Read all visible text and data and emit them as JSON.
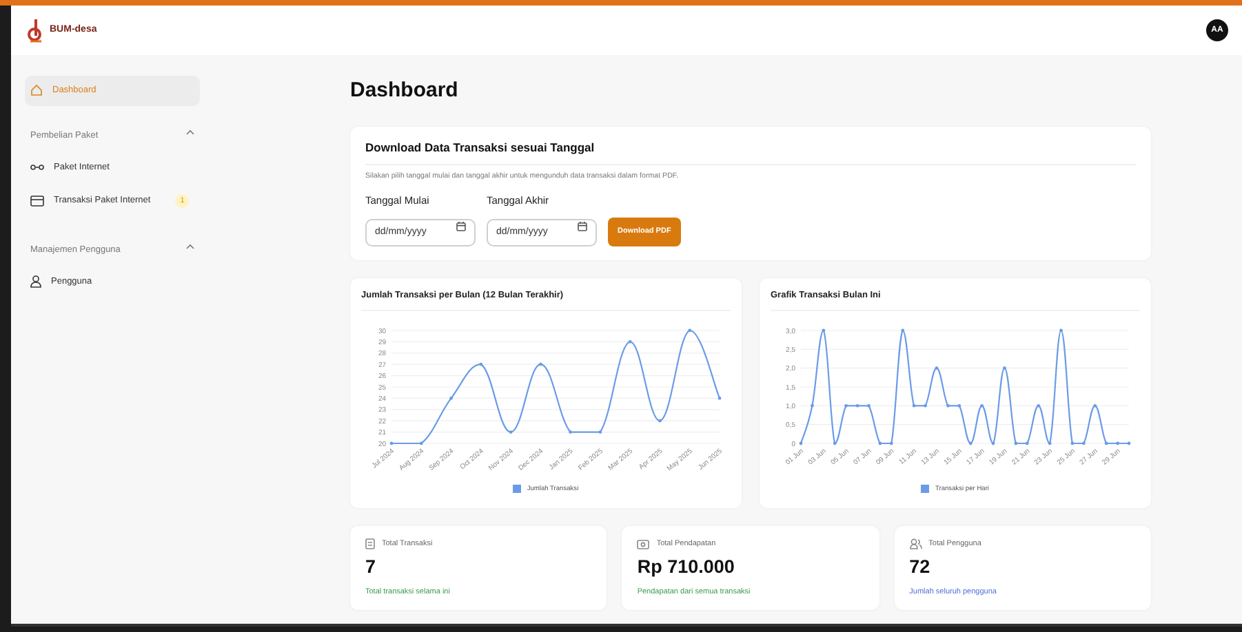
{
  "app": {
    "logo_text": "BUM-desa"
  },
  "user": {
    "initials": "AA"
  },
  "sidebar": {
    "items": [
      {
        "label": "Dashboard",
        "kind": "home",
        "selected": true
      }
    ],
    "sections": [
      {
        "title": "Pembelian Paket",
        "expanded": true,
        "items": [
          {
            "label": "Paket Internet",
            "kind": "wifi",
            "selected": false
          },
          {
            "label": "Transaksi Paket Internet",
            "kind": "card",
            "selected": false,
            "badge": "1"
          }
        ]
      },
      {
        "title": "Manajemen Pengguna",
        "expanded": true,
        "items": [
          {
            "label": "Pengguna",
            "kind": "user",
            "selected": false
          }
        ]
      }
    ]
  },
  "page_title": "Dashboard",
  "download": {
    "title": "Download Data Transaksi sesuai Tanggal",
    "description": "Silakan pilih tanggal mulai dan tanggal akhir untuk mengunduh data transaksi dalam format PDF.",
    "fields": [
      {
        "label": "Tanggal Mulai",
        "placeholder": "dd/mm/yyyy"
      },
      {
        "label": "Tanggal Akhir",
        "placeholder": "dd/mm/yyyy"
      }
    ],
    "button": "Download PDF"
  },
  "charts": [
    {
      "title": "Jumlah Transaksi per Bulan (12 Bulan Terakhir)",
      "chart_data": {
        "type": "line",
        "categories": [
          "Jul 2024",
          "Aug 2024",
          "Sep 2024",
          "Oct 2024",
          "Nov 2024",
          "Dec 2024",
          "Jan 2025",
          "Feb 2025",
          "Mar 2025",
          "Apr 2025",
          "May 2025",
          "Jun 2025"
        ],
        "series": [
          {
            "name": "Jumlah Transaksi",
            "color": "#6b9be8",
            "values": [
              20,
              20,
              24,
              27,
              21,
              27,
              21,
              21,
              29,
              22,
              30,
              24
            ]
          }
        ],
        "ylim": [
          20,
          30
        ],
        "grid": true,
        "yticks": [
          20,
          21,
          22,
          23,
          24,
          25,
          26,
          27,
          28,
          29,
          30
        ]
      }
    },
    {
      "title": "Grafik Transaksi Bulan Ini",
      "chart_data": {
        "type": "line",
        "categories": [
          "01 Jun",
          null,
          "03 Jun",
          null,
          "05 Jun",
          null,
          "07 Jun",
          null,
          "09 Jun",
          null,
          "11 Jun",
          null,
          "13 Jun",
          null,
          "15 Jun",
          null,
          "17 Jun",
          null,
          "19 Jun",
          null,
          "21 Jun",
          null,
          "23 Jun",
          null,
          "25 Jun",
          null,
          "27 Jun",
          null,
          "29 Jun",
          null
        ],
        "series": [
          {
            "name": "Transaksi per Hari",
            "color": "#6b9be8",
            "values": [
              0,
              1,
              3,
              0,
              1,
              1,
              1,
              0,
              0,
              3,
              1,
              1,
              2,
              1,
              1,
              0,
              1,
              0,
              2,
              0,
              0,
              1,
              0,
              3,
              0,
              0,
              1,
              0,
              0,
              0
            ]
          }
        ],
        "ylim": [
          0,
          3
        ],
        "grid": true,
        "yticks": [
          {
            "value": 0,
            "label": "0"
          },
          {
            "value": 0.5,
            "label": "0,5"
          },
          {
            "value": 1,
            "label": "1,0"
          },
          {
            "value": 1.5,
            "label": "1,5"
          },
          {
            "value": 2,
            "label": "2,0"
          },
          {
            "value": 2.5,
            "label": "2,5"
          },
          {
            "value": 3,
            "label": "3,0"
          }
        ]
      }
    }
  ],
  "stats": [
    {
      "kind": "receipt",
      "label": "Total Transaksi",
      "value": "7",
      "caption": "Total transaksi selama ini",
      "color": "#3a9a4a"
    },
    {
      "kind": "money",
      "label": "Total Pendapatan",
      "value": "Rp 710.000",
      "caption": "Pendapatan dari semua transaksi",
      "color": "#3a9a4a"
    },
    {
      "kind": "users",
      "label": "Total Pengguna",
      "value": "72",
      "caption": "Jumlah seluruh pengguna",
      "color": "#4a6fd8"
    }
  ]
}
